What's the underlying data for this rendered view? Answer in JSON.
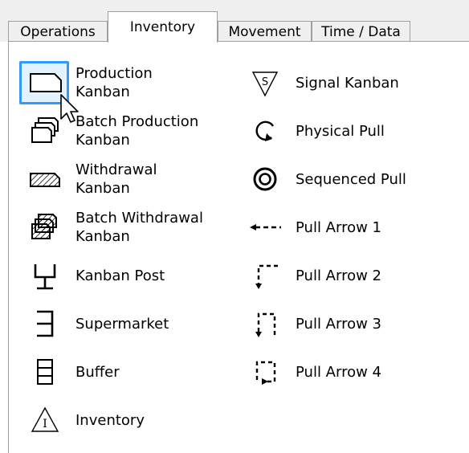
{
  "tabs": [
    {
      "label": "Operations",
      "active": false
    },
    {
      "label": "Inventory",
      "active": true
    },
    {
      "label": "Movement",
      "active": false
    },
    {
      "label": "Time / Data",
      "active": false
    }
  ],
  "left_items": [
    {
      "label": "Production\nKanban",
      "icon": "production-kanban-icon",
      "selected": true
    },
    {
      "label": "Batch Production\nKanban",
      "icon": "batch-production-kanban-icon"
    },
    {
      "label": "Withdrawal\nKanban",
      "icon": "withdrawal-kanban-icon"
    },
    {
      "label": "Batch Withdrawal\nKanban",
      "icon": "batch-withdrawal-kanban-icon"
    },
    {
      "label": "Kanban Post",
      "icon": "kanban-post-icon"
    },
    {
      "label": "Supermarket",
      "icon": "supermarket-icon"
    },
    {
      "label": "Buffer",
      "icon": "buffer-icon"
    },
    {
      "label": "Inventory",
      "icon": "inventory-icon"
    }
  ],
  "right_items": [
    {
      "label": "Signal Kanban",
      "icon": "signal-kanban-icon"
    },
    {
      "label": "Physical Pull",
      "icon": "physical-pull-icon"
    },
    {
      "label": "Sequenced Pull",
      "icon": "sequenced-pull-icon"
    },
    {
      "label": "Pull Arrow 1",
      "icon": "pull-arrow-1-icon"
    },
    {
      "label": "Pull Arrow 2",
      "icon": "pull-arrow-2-icon"
    },
    {
      "label": "Pull Arrow 3",
      "icon": "pull-arrow-3-icon"
    },
    {
      "label": "Pull Arrow 4",
      "icon": "pull-arrow-4-icon"
    }
  ],
  "icon_glyphs": {
    "signal_letter": "S",
    "inventory_letter": "I"
  },
  "colors": {
    "selection_border": "#3399ff",
    "tab_border": "#a0a0a0"
  }
}
